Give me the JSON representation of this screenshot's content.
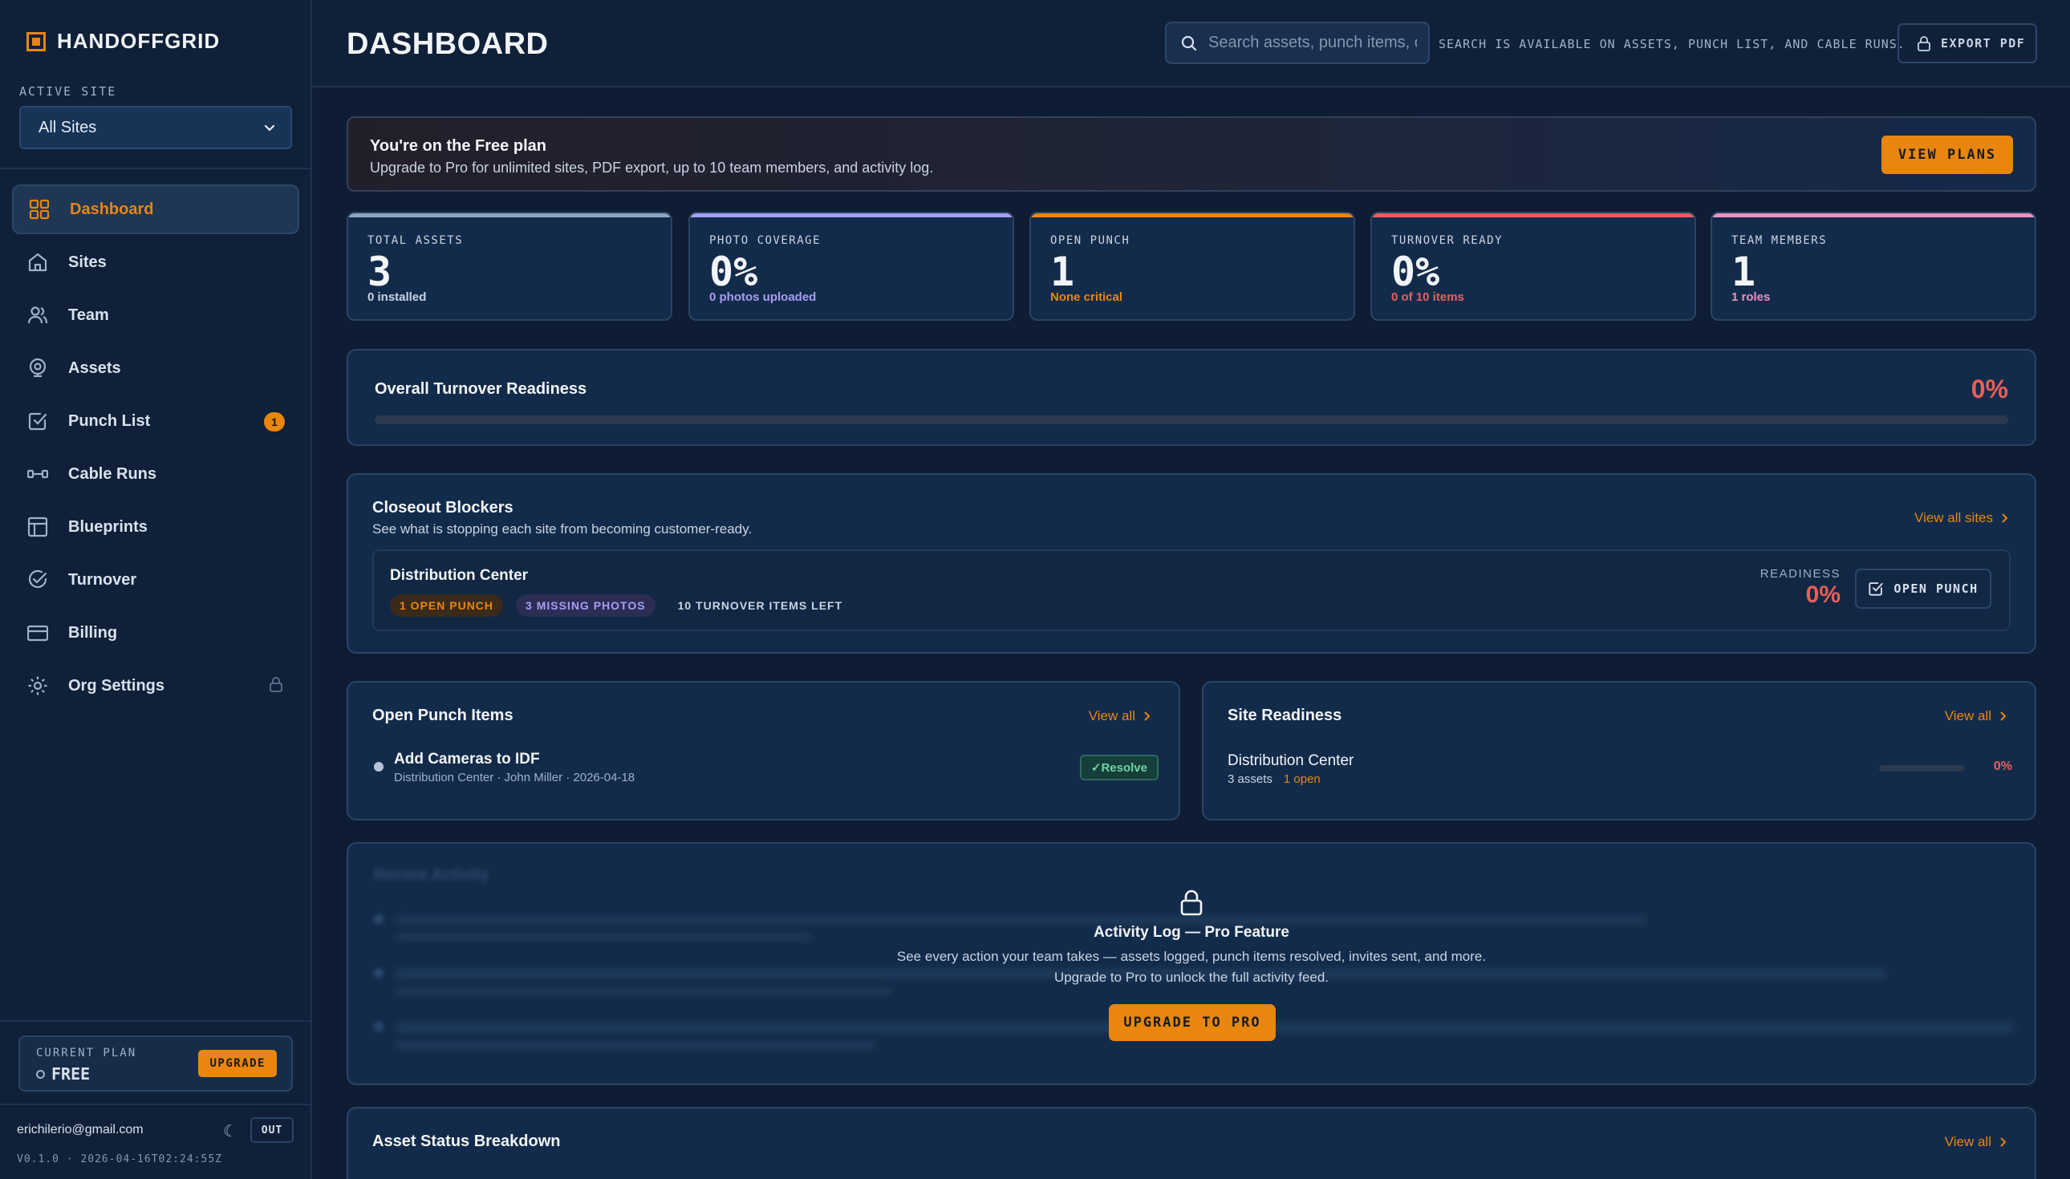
{
  "app": {
    "name": "HANDOFFGRID",
    "page_title": "DASHBOARD"
  },
  "sidebar": {
    "active_site_label": "ACTIVE SITE",
    "active_site_value": "All Sites",
    "items": [
      {
        "label": "Dashboard",
        "icon": "dashboard-grid-icon",
        "active": true
      },
      {
        "label": "Sites",
        "icon": "home-icon"
      },
      {
        "label": "Team",
        "icon": "users-icon"
      },
      {
        "label": "Assets",
        "icon": "cctv-icon"
      },
      {
        "label": "Punch List",
        "icon": "checkbox-icon",
        "badge": "1"
      },
      {
        "label": "Cable Runs",
        "icon": "cable-icon"
      },
      {
        "label": "Blueprints",
        "icon": "blueprint-icon"
      },
      {
        "label": "Turnover",
        "icon": "check-circle-icon"
      },
      {
        "label": "Billing",
        "icon": "credit-card-icon"
      },
      {
        "label": "Org Settings",
        "icon": "gear-icon",
        "locked": true
      }
    ],
    "plan_label": "CURRENT PLAN",
    "plan_value": "FREE",
    "upgrade_label": "UPGRADE",
    "user_email": "erichilerio@gmail.com",
    "out_label": "OUT",
    "version": "V0.1.0 · 2026-04-16T02:24:55Z"
  },
  "header": {
    "search_placeholder": "Search assets, punch items, or cable runs",
    "search_hint": "SEARCH IS AVAILABLE ON ASSETS, PUNCH LIST, AND CABLE RUNS.",
    "export_label": "EXPORT PDF"
  },
  "upsell": {
    "title": "You're on the Free plan",
    "text": "Upgrade to Pro for unlimited sites, PDF export, up to 10 team members, and activity log.",
    "button": "VIEW PLANS"
  },
  "stats": [
    {
      "label": "TOTAL ASSETS",
      "value": "3",
      "sub": "0 installed",
      "accent": "#8fa4bf",
      "sub_color": "#c9d4e3"
    },
    {
      "label": "PHOTO COVERAGE",
      "value": "0%",
      "sub": "0 photos uploaded",
      "accent": "#a99cf2",
      "sub_color": "#a99cf2"
    },
    {
      "label": "OPEN PUNCH",
      "value": "1",
      "sub": "None critical",
      "accent": "#e8860f",
      "sub_color": "#e8860f"
    },
    {
      "label": "TURNOVER READY",
      "value": "0%",
      "sub": "0 of 10 items",
      "accent": "#e8605a",
      "sub_color": "#e8605a"
    },
    {
      "label": "TEAM MEMBERS",
      "value": "1",
      "sub": "1 roles",
      "accent": "#f08fc0",
      "sub_color": "#f08fc0"
    }
  ],
  "readiness": {
    "title": "Overall Turnover Readiness",
    "value": "0%",
    "fraction": 0.0
  },
  "blockers": {
    "title": "Closeout Blockers",
    "subtitle": "See what is stopping each site from becoming customer-ready.",
    "view_all": "View all sites",
    "site": {
      "name": "Distribution Center",
      "tags": [
        "1 OPEN PUNCH",
        "3 MISSING PHOTOS",
        "10 TURNOVER ITEMS LEFT"
      ],
      "readiness_label": "READINESS",
      "readiness_value": "0%",
      "open_punch_button": "OPEN PUNCH"
    }
  },
  "open_punch": {
    "title": "Open Punch Items",
    "view_all": "View all",
    "items": [
      {
        "title": "Add Cameras to IDF",
        "meta": "Distribution Center · John Miller · 2026-04-18",
        "action": "✓Resolve"
      }
    ]
  },
  "site_readiness": {
    "title": "Site Readiness",
    "view_all": "View all",
    "sites": [
      {
        "name": "Distribution Center",
        "assets": "3 assets",
        "open": "1 open",
        "value": "0%",
        "fraction": 0.0
      }
    ]
  },
  "activity": {
    "title": "Recent Activity",
    "lock_title": "Activity Log — Pro Feature",
    "lock_text_1": "See every action your team takes — assets logged, punch items resolved, invites sent, and more.",
    "lock_text_2": "Upgrade to Pro to unlock the full activity feed.",
    "button": "UPGRADE TO PRO"
  },
  "asset_status": {
    "title": "Asset Status Breakdown",
    "view_all": "View all"
  }
}
